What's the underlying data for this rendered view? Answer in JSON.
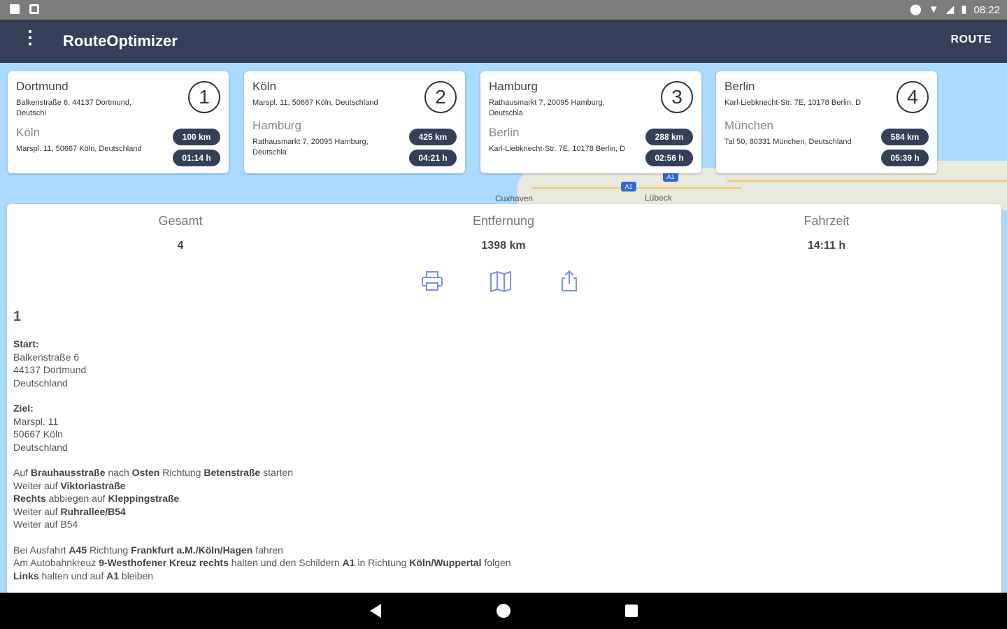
{
  "status_bar": {
    "time": "08:22",
    "icons": [
      "sd-card-icon",
      "notification-icon",
      "location-icon",
      "wifi-icon",
      "signal-icon",
      "battery-icon"
    ]
  },
  "app_bar": {
    "title": "RouteOptimizer",
    "action_label": "ROUTE",
    "background": "#353f57"
  },
  "map": {
    "labels": [
      "Cuxhaven",
      "Lübeck"
    ],
    "shields": [
      "A1",
      "A1"
    ]
  },
  "stops": [
    {
      "number": "1",
      "city": "Dortmund",
      "address": "Balkenstraße 6, 44137 Dortmund, Deutschl",
      "next_city": "Köln",
      "next_address": "Marspl. 11, 50667 Köln, Deutschland",
      "distance": "100 km",
      "duration": "01:14 h"
    },
    {
      "number": "2",
      "city": "Köln",
      "address": "Marspl. 11, 50667 Köln, Deutschland",
      "next_city": "Hamburg",
      "next_address": "Rathausmarkt 7, 20095 Hamburg, Deutschla",
      "distance": "425 km",
      "duration": "04:21 h"
    },
    {
      "number": "3",
      "city": "Hamburg",
      "address": "Rathausmarkt 7, 20095 Hamburg, Deutschla",
      "next_city": "Berlin",
      "next_address": "Karl-Liebknecht-Str. 7E, 10178 Berlin, D",
      "distance": "288 km",
      "duration": "02:56 h"
    },
    {
      "number": "4",
      "city": "Berlin",
      "address": "Karl-Liebknecht-Str. 7E, 10178 Berlin, D",
      "next_city": "München",
      "next_address": "Tal 50, 80331 München, Deutschland",
      "distance": "584 km",
      "duration": "05:39 h"
    }
  ],
  "summary": {
    "total_label": "Gesamt",
    "total_value": "4",
    "distance_label": "Entfernung",
    "distance_value": "1398 km",
    "time_label": "Fahrzeit",
    "time_value": "14:11 h"
  },
  "actions": [
    "print-icon",
    "map-icon",
    "share-icon"
  ],
  "leg": {
    "number": "1",
    "start_label": "Start:",
    "start_lines": [
      "Balkenstraße 6",
      "44137 Dortmund",
      "Deutschland"
    ],
    "dest_label": "Ziel:",
    "dest_lines": [
      "Marspl. 11",
      "50667 Köln",
      "Deutschland"
    ],
    "directions_1": [
      [
        {
          "t": "Auf ",
          "b": false
        },
        {
          "t": "Brauhausstraße",
          "b": true
        },
        {
          "t": " nach ",
          "b": false
        },
        {
          "t": "Osten",
          "b": true
        },
        {
          "t": " Richtung ",
          "b": false
        },
        {
          "t": "Betenstraße",
          "b": true
        },
        {
          "t": " starten",
          "b": false
        }
      ],
      [
        {
          "t": "Weiter auf ",
          "b": false
        },
        {
          "t": "Viktoriastraße",
          "b": true
        }
      ],
      [
        {
          "t": "Rechts",
          "b": true
        },
        {
          "t": " abbiegen auf ",
          "b": false
        },
        {
          "t": "Kleppingstraße",
          "b": true
        }
      ],
      [
        {
          "t": "Weiter auf ",
          "b": false
        },
        {
          "t": "Ruhrallee/B54",
          "b": true
        }
      ],
      [
        {
          "t": "Weiter auf B54",
          "b": false
        }
      ]
    ],
    "directions_2": [
      [
        {
          "t": "Bei Ausfahrt ",
          "b": false
        },
        {
          "t": "A45",
          "b": true
        },
        {
          "t": " Richtung ",
          "b": false
        },
        {
          "t": "Frankfurt a.M./Köln/Hagen",
          "b": true
        },
        {
          "t": " fahren",
          "b": false
        }
      ],
      [
        {
          "t": "Am Autobahnkreuz ",
          "b": false
        },
        {
          "t": "9-Westhofener Kreuz rechts",
          "b": true
        },
        {
          "t": " halten und den Schildern ",
          "b": false
        },
        {
          "t": "A1",
          "b": true
        },
        {
          "t": " in Richtung ",
          "b": false
        },
        {
          "t": "Köln/Wuppertal",
          "b": true
        },
        {
          "t": " folgen",
          "b": false
        }
      ],
      [
        {
          "t": "Links",
          "b": true
        },
        {
          "t": " halten und auf ",
          "b": false
        },
        {
          "t": "A1",
          "b": true
        },
        {
          "t": " bleiben",
          "b": false
        }
      ]
    ]
  }
}
